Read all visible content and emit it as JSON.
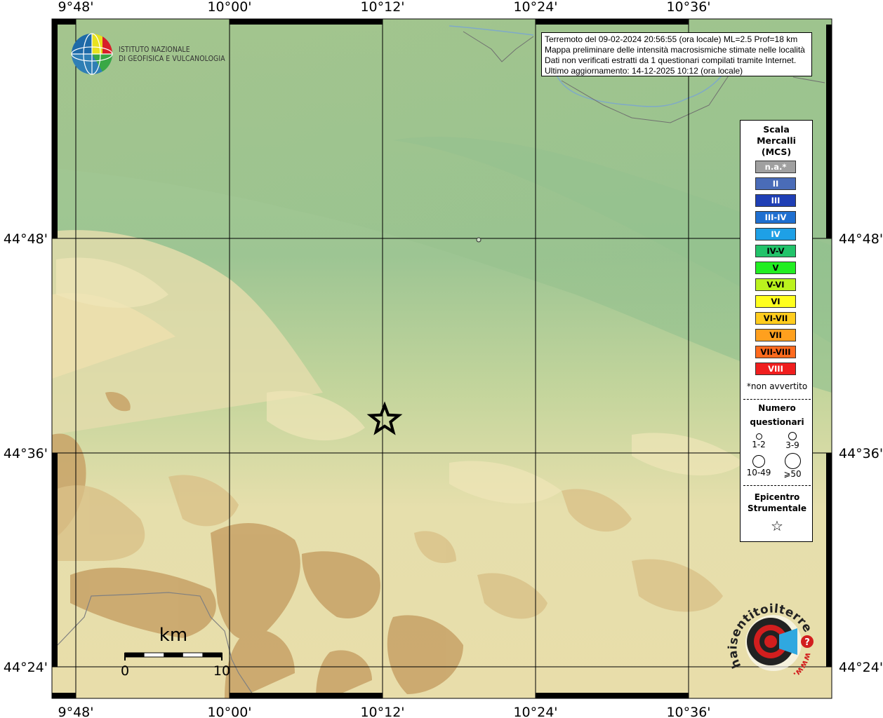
{
  "map": {
    "lon_labels": [
      "9°48'",
      "10°00'",
      "10°12'",
      "10°24'",
      "10°36'"
    ],
    "lat_labels": [
      "44°48'",
      "44°36'",
      "44°24'"
    ],
    "epicenter": {
      "lon": "10°12'",
      "lat": "44°37'"
    },
    "report_point": {
      "lon": "10°19'",
      "lat": "44°48'"
    }
  },
  "logo": {
    "line1": "ISTITUTO NAZIONALE",
    "line2": "DI GEOFISICA E VULCANOLOGIA"
  },
  "info": {
    "line1": "Terremoto del 09-02-2024 20:56:55 (ora locale) ML=2.5 Prof=18 km",
    "line2": "Mappa preliminare delle intensità macrosismiche stimate nelle località",
    "line3": "Dati non verificati estratti da 1 questionari compilati tramite Internet.",
    "line4": "Ultimo aggiornamento: 14-12-2025 10:12 (ora locale)"
  },
  "legend": {
    "title1": "Scala",
    "title2": "Mercalli",
    "title3": "(MCS)",
    "scale": [
      {
        "label": "n.a.*",
        "color": "#a0a0a0",
        "text_color": "#ffffff"
      },
      {
        "label": "II",
        "color": "#4a6cb8",
        "text_color": "#ffffff"
      },
      {
        "label": "III",
        "color": "#1f3fb5",
        "text_color": "#ffffff"
      },
      {
        "label": "III-IV",
        "color": "#1f6fd0",
        "text_color": "#ffffff"
      },
      {
        "label": "IV",
        "color": "#1ea0e6",
        "text_color": "#ffffff"
      },
      {
        "label": "IV-V",
        "color": "#22c36a",
        "text_color": "#000000"
      },
      {
        "label": "V",
        "color": "#22ee22",
        "text_color": "#000000"
      },
      {
        "label": "V-VI",
        "color": "#bbf21e",
        "text_color": "#000000"
      },
      {
        "label": "VI",
        "color": "#ffff1e",
        "text_color": "#000000"
      },
      {
        "label": "VI-VII",
        "color": "#ffcc1e",
        "text_color": "#000000"
      },
      {
        "label": "VII",
        "color": "#ffa01e",
        "text_color": "#000000"
      },
      {
        "label": "VII-VIII",
        "color": "#ff6a1e",
        "text_color": "#000000"
      },
      {
        "label": "VIII",
        "color": "#f01e1e",
        "text_color": "#ffffff"
      }
    ],
    "note": "*non avvertito",
    "count_title1": "Numero",
    "count_title2": "questionari",
    "counts": [
      "1-2",
      "3-9",
      "10-49",
      "⩾50"
    ],
    "epi_title1": "Epicentro",
    "epi_title2": "Strumentale",
    "epi_symbol": "☆"
  },
  "scalebar": {
    "unit": "km",
    "start": "0",
    "end": "10"
  },
  "brand": {
    "text": "haisentitoilterremoto.it",
    "url": "www.",
    "question": "?"
  }
}
